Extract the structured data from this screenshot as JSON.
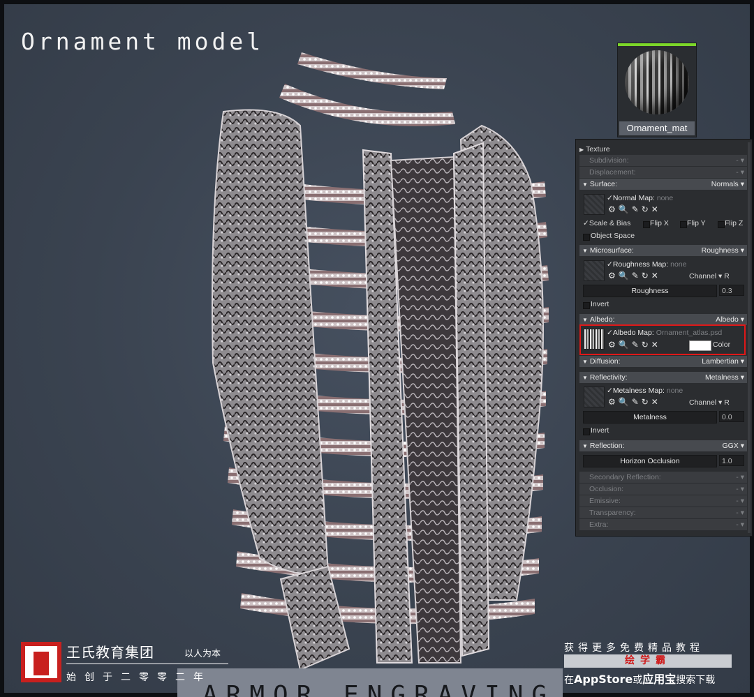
{
  "title": "Ornament model",
  "material": {
    "name": "Ornament_mat"
  },
  "panel": {
    "texture": "Texture",
    "subdivision": "Subdivision:",
    "displacement": "Displacement:",
    "surface": {
      "label": "Surface:",
      "value": "Normals"
    },
    "normal_map": {
      "label": "Normal Map:",
      "value": "none"
    },
    "scale_bias": "Scale & Bias",
    "flip_x": "Flip X",
    "flip_y": "Flip Y",
    "flip_z": "Flip Z",
    "object_space": "Object Space",
    "microsurface": {
      "label": "Microsurface:",
      "value": "Roughness"
    },
    "roughness_map": {
      "label": "Roughness Map:",
      "value": "none"
    },
    "channel_label": "Channel",
    "channel_r": "R",
    "roughness": {
      "label": "Roughness",
      "value": "0.3"
    },
    "invert": "Invert",
    "albedo": {
      "label": "Albedo:",
      "value": "Albedo"
    },
    "albedo_map": {
      "label": "Albedo Map:",
      "value": "Ornament_atlas.psd"
    },
    "color": "Color",
    "diffusion": {
      "label": "Diffusion:",
      "value": "Lambertian"
    },
    "reflectivity": {
      "label": "Reflectivity:",
      "value": "Metalness"
    },
    "metalness_map": {
      "label": "Metalness Map:",
      "value": "none"
    },
    "metalness": {
      "label": "Metalness",
      "value": "0.0"
    },
    "reflection": {
      "label": "Reflection:",
      "value": "GGX"
    },
    "horizon": {
      "label": "Horizon Occlusion",
      "value": "1.0"
    },
    "secondary_reflection": "Secondary Reflection:",
    "occlusion": "Occlusion:",
    "emissive": "Emissive:",
    "transparency": "Transparency:",
    "extra": "Extra:",
    "dash": "-"
  },
  "footer": {
    "org": "王氏教育集团",
    "motto": "以人为本",
    "since": "始创于二零零二年",
    "promo": "获得更多免费精品教程",
    "brand": "绘学霸",
    "store_prefix": "在",
    "store_app": "AppStore",
    "store_or": "或",
    "store_yyb": "应用宝",
    "store_suffix": "搜索下载"
  },
  "banner": "ARMOR ENGRAVING",
  "colors": {
    "accent_green": "#7cd62a",
    "highlight_red": "#e01818",
    "brand_red": "#c8201e"
  }
}
